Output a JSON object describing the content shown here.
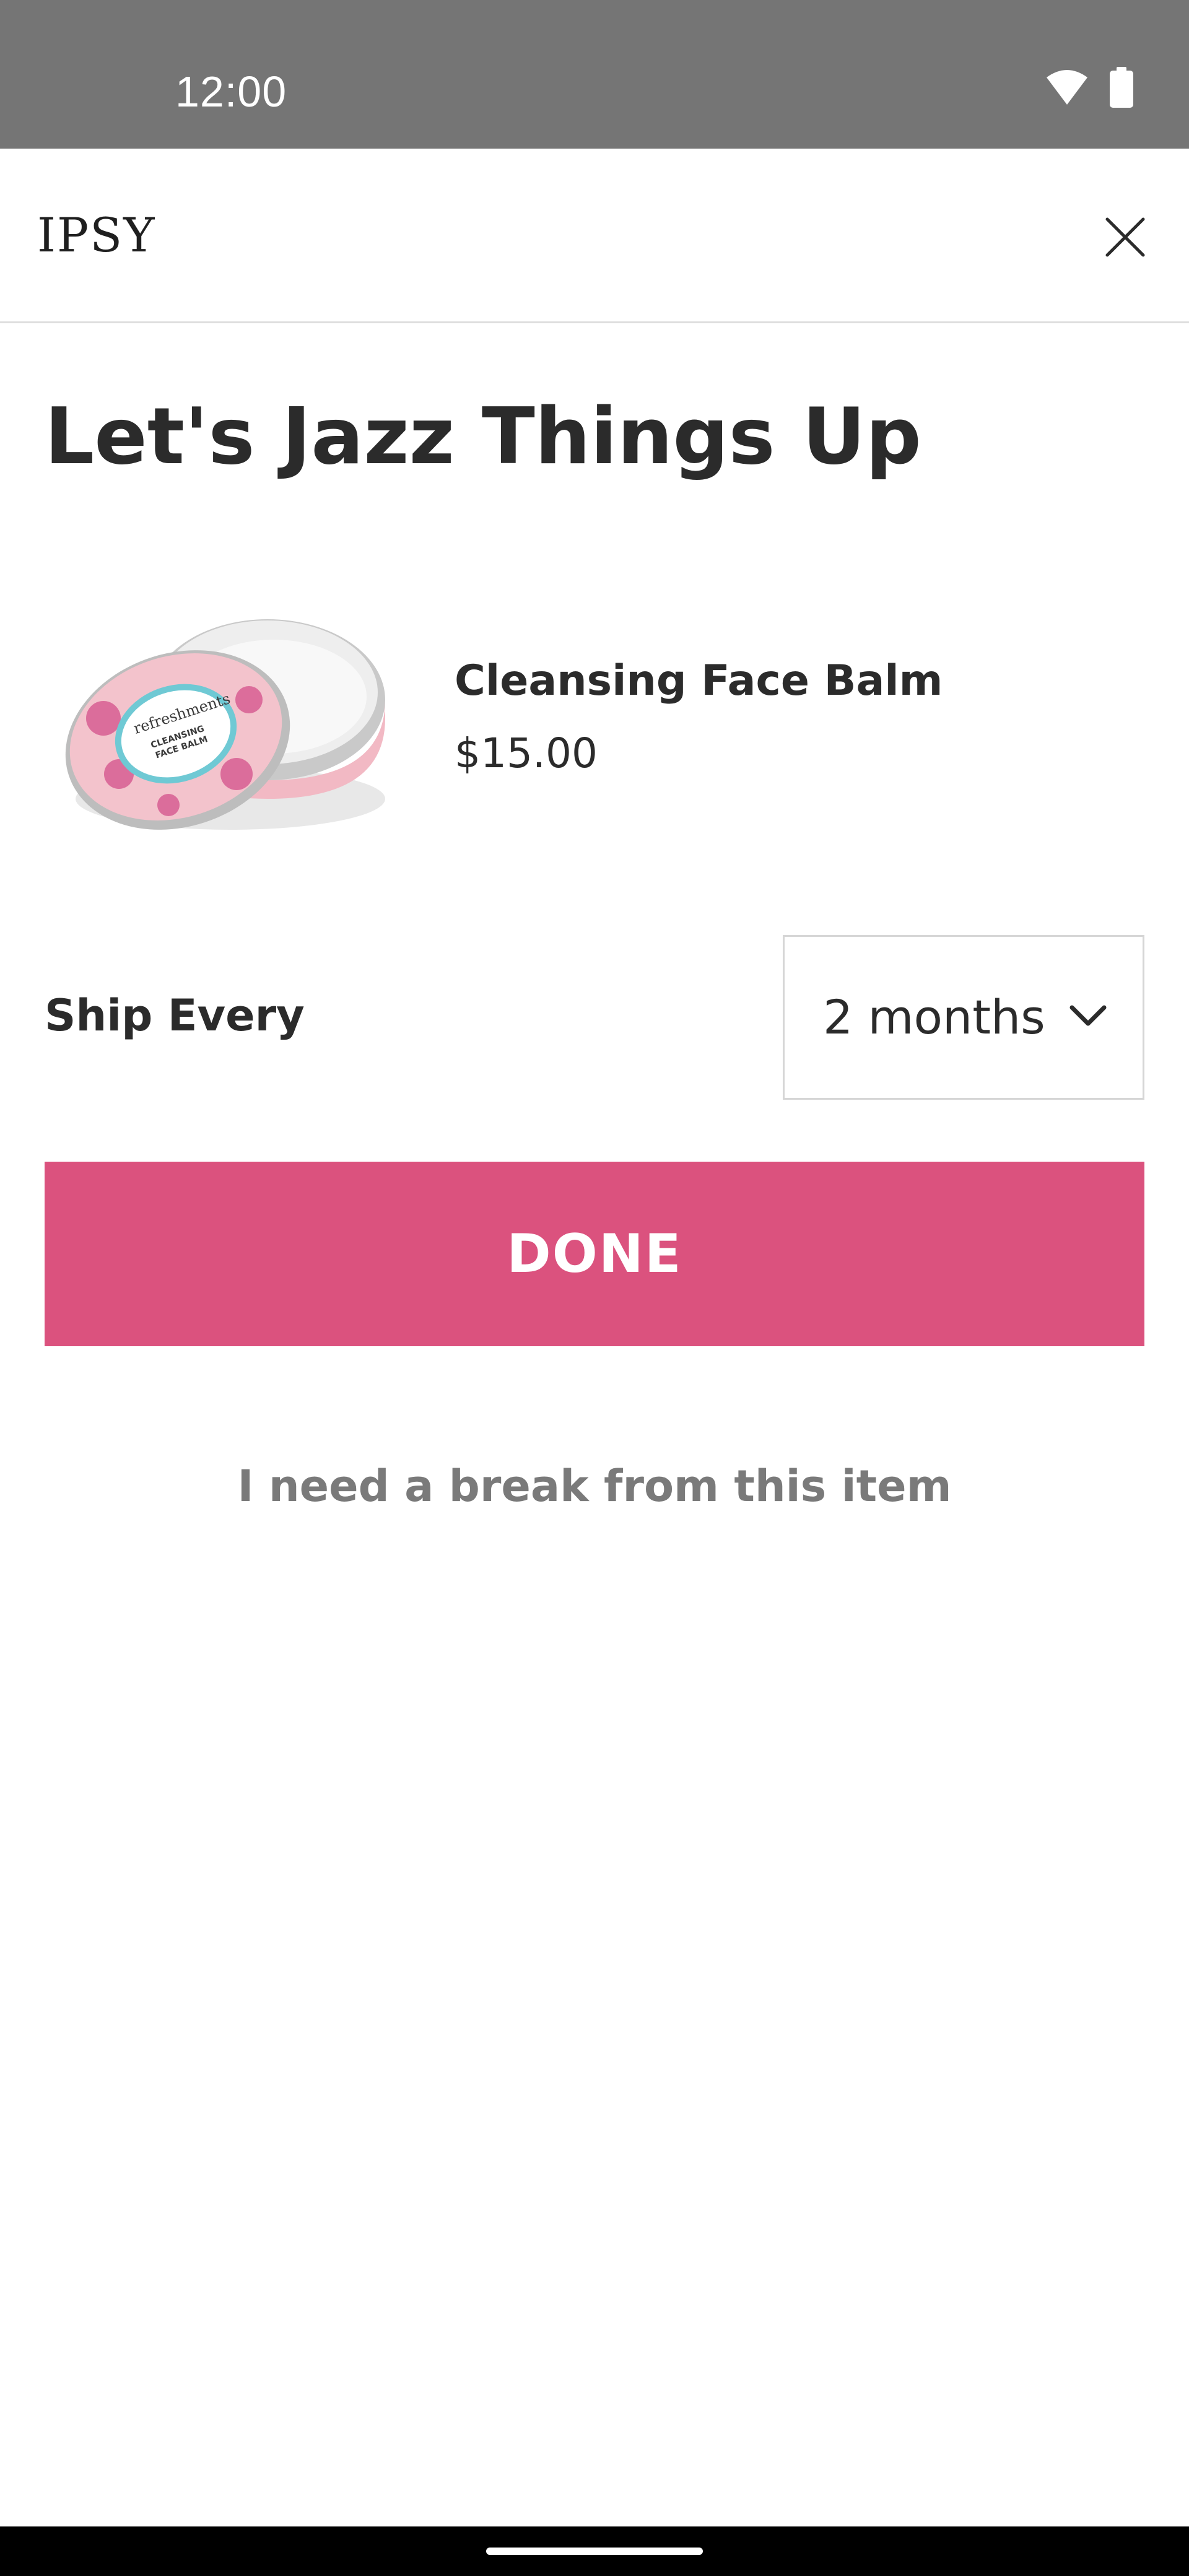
{
  "status_bar": {
    "time": "12:00",
    "icons": [
      "wifi-icon",
      "battery-icon"
    ]
  },
  "header": {
    "brand": "IPSY",
    "close_icon": "close-icon"
  },
  "page": {
    "title": "Let's Jazz Things Up"
  },
  "product": {
    "name": "Cleansing Face Balm",
    "price": "$15.00",
    "image_label": "refreshments",
    "image_sublabel_1": "CLEANSING",
    "image_sublabel_2": "FACE BALM"
  },
  "shipping": {
    "label": "Ship Every",
    "selected": "2 months"
  },
  "actions": {
    "done_label": "DONE",
    "break_label": "I need a break from this item"
  },
  "colors": {
    "accent": "#db527e",
    "status_bar": "#757575",
    "text": "#2b2b2b",
    "muted": "#7a7a7a"
  }
}
